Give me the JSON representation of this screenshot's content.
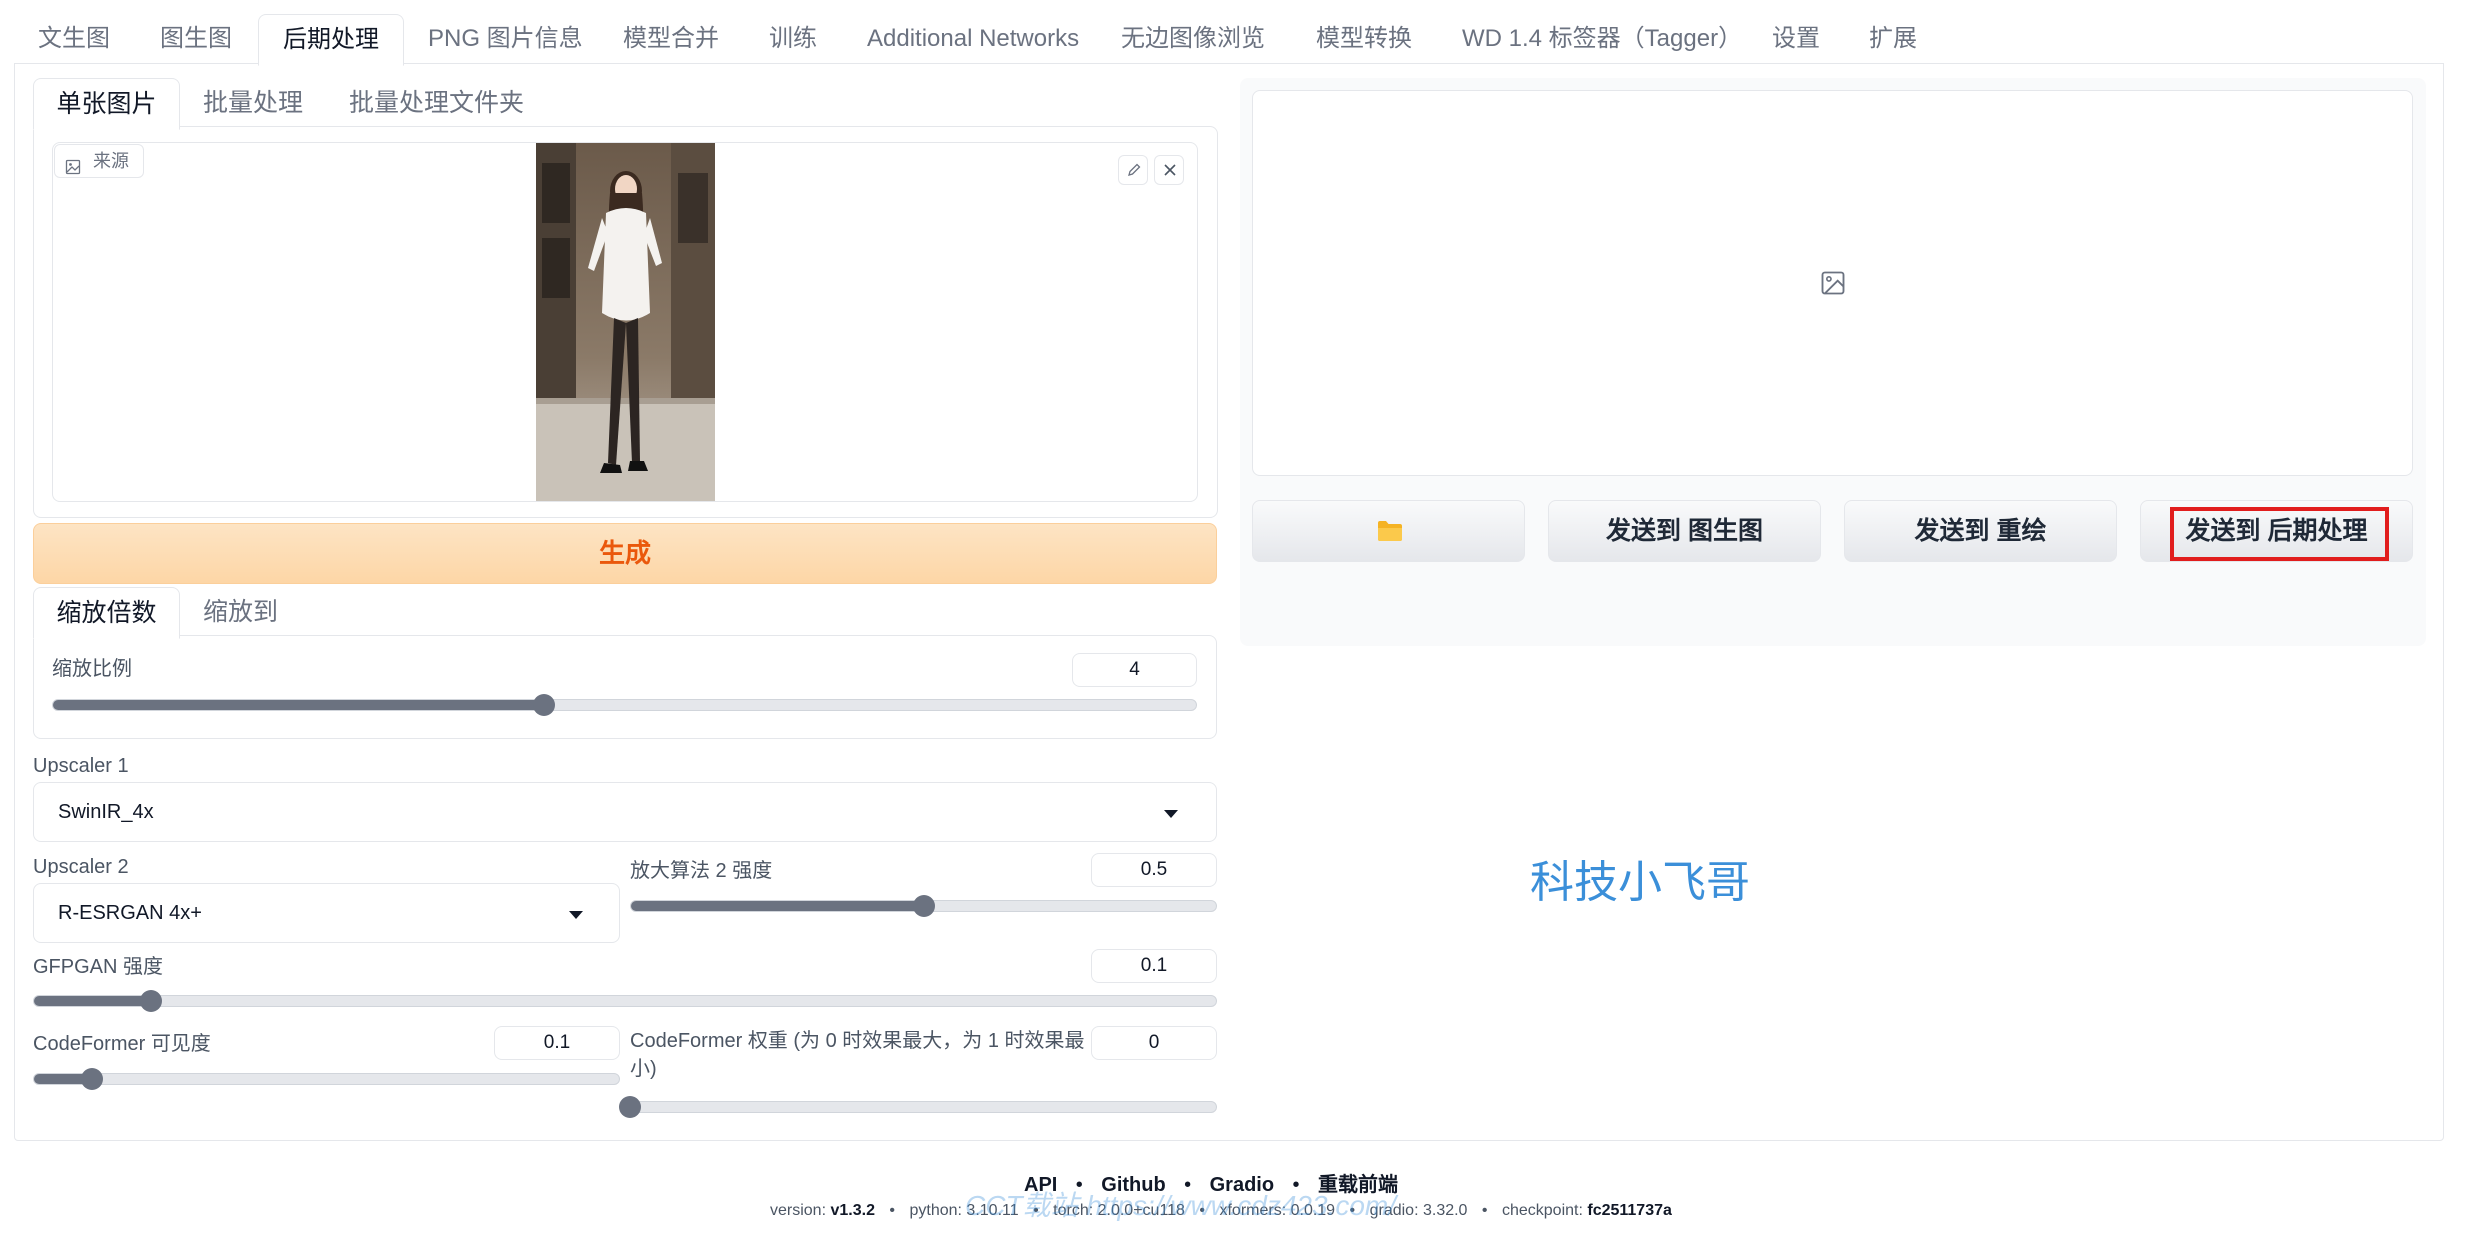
{
  "top_tabs": [
    "文生图",
    "图生图",
    "后期处理",
    "PNG 图片信息",
    "模型合并",
    "训练",
    "Additional Networks",
    "无边图像浏览",
    "模型转换",
    "WD 1.4 标签器（Tagger）",
    "设置",
    "扩展"
  ],
  "mode_tabs": [
    "单张图片",
    "批量处理",
    "批量处理文件夹"
  ],
  "source": {
    "label": "来源"
  },
  "generate_label": "生成",
  "scale_tabs": [
    "缩放倍数",
    "缩放到"
  ],
  "resize": {
    "label": "缩放比例",
    "value": "4",
    "fraction": 0.43
  },
  "upscaler1": {
    "label": "Upscaler 1",
    "value": "SwinIR_4x"
  },
  "upscaler2": {
    "label": "Upscaler 2",
    "value": "R-ESRGAN 4x+"
  },
  "upscaler2_visibility": {
    "label": "放大算法 2 强度",
    "value": "0.5",
    "fraction": 0.5
  },
  "gfpgan": {
    "label": "GFPGAN 强度",
    "value": "0.1",
    "fraction": 0.1
  },
  "codeformer_visibility": {
    "label": "CodeFormer 可见度",
    "value": "0.1",
    "fraction": 0.1
  },
  "codeformer_weight": {
    "label": "CodeFormer 权重 (为 0 时效果最大，为 1 时效果最小)",
    "value": "0",
    "fraction": 0.0
  },
  "output_buttons": {
    "folder_icon": "folder-icon",
    "send_img2img": "发送到 图生图",
    "send_inpaint": "发送到 重绘",
    "send_extras": "发送到 后期处理"
  },
  "watermark": "科技小飞哥",
  "footer": {
    "links": [
      "API",
      "Github",
      "Gradio",
      "重载前端"
    ],
    "version_label": "version:",
    "version": "v1.3.2",
    "python_label": "python:",
    "python": "3.10.11",
    "torch_label": "torch:",
    "torch": "2.0.0+cu118",
    "xformers_label": "xformers:",
    "xformers": "0.0.19",
    "gradio_label": "gradio:",
    "gradio": "3.32.0",
    "checkpoint_label": "checkpoint:",
    "checkpoint": "fc2511737a"
  },
  "footer_watermark": "CCT载站 https://www.cdz423.com/",
  "colors": {
    "generate_text": "#ea580c",
    "highlight_border": "#e11d1d",
    "watermark": "#3b8fd9",
    "slider_fill": "#6b7280"
  }
}
